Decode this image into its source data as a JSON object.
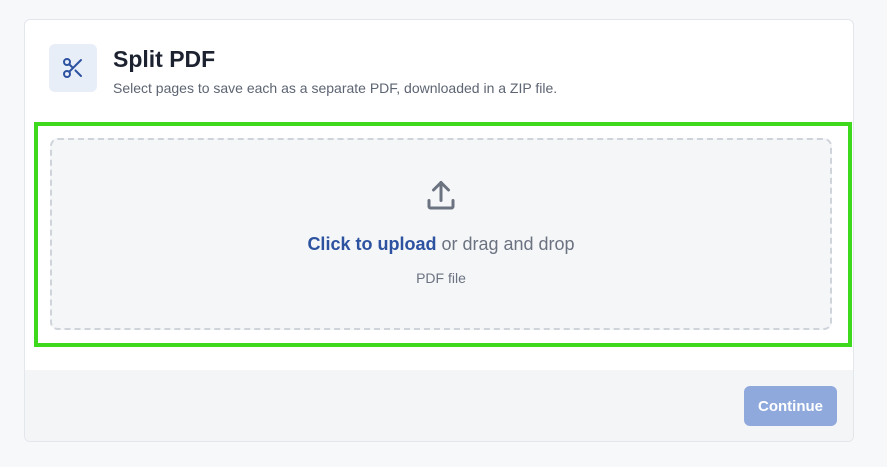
{
  "header": {
    "title": "Split PDF",
    "subtitle": "Select pages to save each as a separate PDF, downloaded in a ZIP file.",
    "icon": "scissors-icon"
  },
  "dropzone": {
    "link_label": "Click to upload",
    "rest_label": " or drag and drop",
    "hint": "PDF file",
    "icon": "upload-icon"
  },
  "footer": {
    "continue_label": "Continue"
  },
  "colors": {
    "accent": "#2c52a0",
    "button_disabled": "#8fa9dd",
    "highlight": "#3ed81c"
  }
}
